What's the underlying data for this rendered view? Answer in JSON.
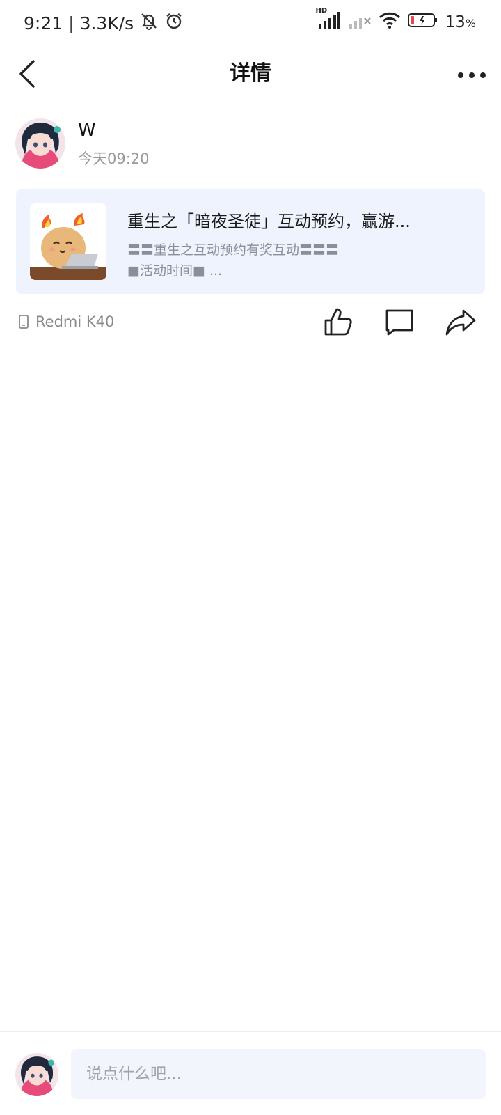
{
  "status_bar": {
    "time": "9:21",
    "net_speed": "3.3K/s",
    "battery": "13",
    "battery_unit": "%",
    "signal_label": "HD",
    "icons": [
      "mute-icon",
      "alarm-icon",
      "signal-icon",
      "signal-weak-icon",
      "wifi-icon",
      "battery-icon"
    ]
  },
  "nav": {
    "title": "详情"
  },
  "author": {
    "name": "W",
    "time": "今天09:20"
  },
  "card": {
    "title": "重生之「暗夜圣徒」互动预约，赢游...",
    "desc_line1": "〓〓重生之互动预约有奖互动〓〓〓",
    "desc_line2": "■活动时间■ ..."
  },
  "device": {
    "label": "Redmi K40"
  },
  "comment": {
    "placeholder": "说点什么吧..."
  },
  "colors": {
    "card_bg": "#eef3fd",
    "input_bg": "#f2f5fb",
    "battery_low": "#e8474c"
  }
}
